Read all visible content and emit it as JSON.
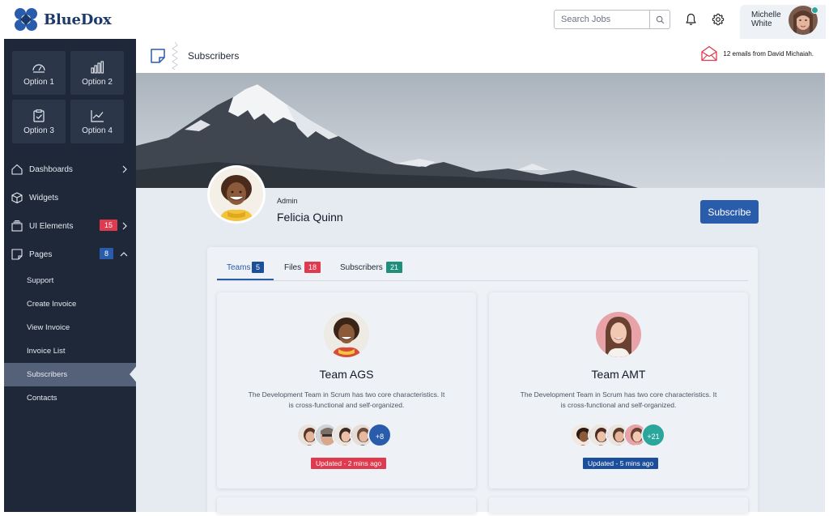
{
  "brand": {
    "name": "BlueDox"
  },
  "header": {
    "search_placeholder": "Search Jobs",
    "user_name": "Michelle White"
  },
  "sidebar": {
    "options": [
      {
        "label": "Option 1",
        "icon": "gauge-icon"
      },
      {
        "label": "Option 2",
        "icon": "bar-chart-icon"
      },
      {
        "label": "Option 3",
        "icon": "clipboard-check-icon"
      },
      {
        "label": "Option 4",
        "icon": "trend-chart-icon"
      }
    ],
    "nav": [
      {
        "label": "Dashboards",
        "icon": "home-icon"
      },
      {
        "label": "Widgets",
        "icon": "cube-icon"
      },
      {
        "label": "UI Elements",
        "icon": "layers-icon",
        "badge": "15"
      },
      {
        "label": "Pages",
        "icon": "pages-icon",
        "badge": "8"
      }
    ],
    "subnav": [
      "Support",
      "Create Invoice",
      "View Invoice",
      "Invoice List",
      "Subscribers",
      "Contacts"
    ],
    "active_subnav": "Subscribers"
  },
  "page": {
    "title": "Subscribers",
    "notification": "12 emails from David Michaiah."
  },
  "profile": {
    "role": "Admin",
    "name": "Felicia Quinn",
    "subscribe_label": "Subscribe"
  },
  "tabs": [
    {
      "label": "Teams",
      "count": "5",
      "color": "#1b4f9c"
    },
    {
      "label": "Files",
      "count": "18",
      "color": "#e03a4e"
    },
    {
      "label": "Subscribers",
      "count": "21",
      "color": "#1f8f7c"
    }
  ],
  "teams": [
    {
      "title": "Team AGS",
      "description": "The Development Team in Scrum has two core characteristics. It is cross-functional and self-organized.",
      "more": "+8",
      "more_color": "#2a5cac",
      "updated": "Updated - 2 mins ago",
      "updated_color": "#e03a4e"
    },
    {
      "title": "Team AMT",
      "description": "The Development Team in Scrum has two core characteristics. It is cross-functional and self-organized.",
      "more": "+21",
      "more_color": "#2aa69b",
      "updated": "Updated - 5 mins ago",
      "updated_color": "#1b4f9c"
    }
  ],
  "colors": {
    "sidebar_bg": "#1e2838",
    "accent": "#2a5cac",
    "danger": "#e03a4e",
    "info": "#2a5cac",
    "success": "#1f8f7c"
  }
}
